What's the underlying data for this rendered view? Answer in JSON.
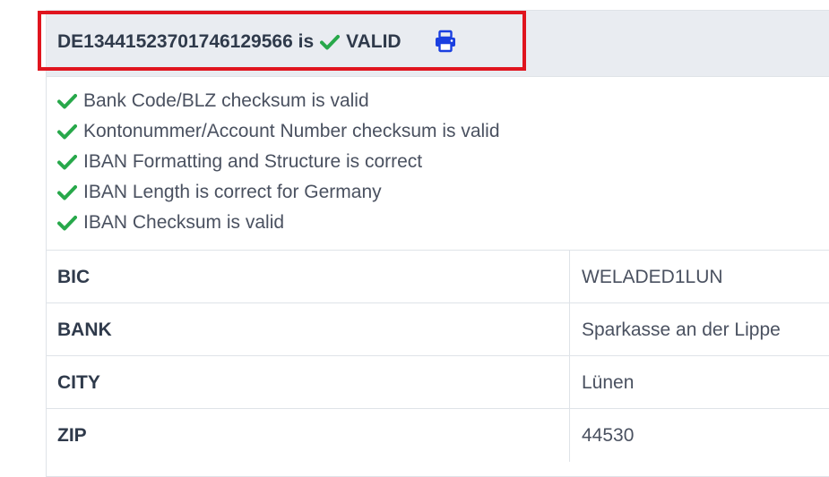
{
  "result": {
    "iban": "DE13441523701746129566",
    "is_text": "is",
    "status": "VALID",
    "print_icon": "print-icon",
    "check_icon": "check-icon"
  },
  "colors": {
    "highlight_border": "#e0141e",
    "check_green": "#27a84a",
    "print_blue": "#1a3fe0",
    "header_bg": "#e9ecf1"
  },
  "checks": [
    {
      "text": "Bank Code/BLZ checksum is valid"
    },
    {
      "text": "Kontonummer/Account Number checksum is valid"
    },
    {
      "text": "IBAN Formatting and Structure is correct"
    },
    {
      "text": "IBAN Length is correct for Germany"
    },
    {
      "text": "IBAN Checksum is valid"
    }
  ],
  "details": [
    {
      "key": "BIC",
      "value": "WELADED1LUN"
    },
    {
      "key": "BANK",
      "value": "Sparkasse an der Lippe"
    },
    {
      "key": "CITY",
      "value": "Lünen"
    },
    {
      "key": "ZIP",
      "value": "44530"
    }
  ]
}
